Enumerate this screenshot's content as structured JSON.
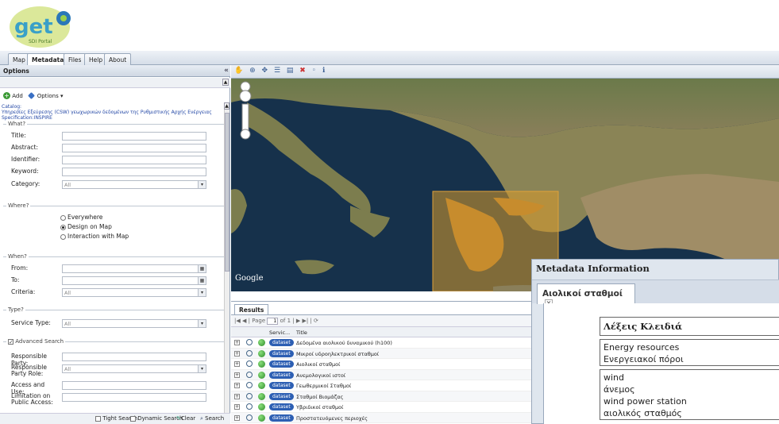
{
  "header": {
    "logo_text": "get",
    "logo_sub": "SDI Portal"
  },
  "tabs": [
    "Map",
    "Metadata",
    "Files",
    "Help",
    "About"
  ],
  "left": {
    "title": "Options",
    "toolbar": {
      "add": "Add",
      "options": "Options ▾"
    },
    "catalog": "Catalog:\nΥπηρεσίες Εξεύρεσης (CSW) γεωχωρικών δεδομένων της Ρυθμιστικής Αρχής Ενέργειας\nSpecification:INSPIRE",
    "what": {
      "legend": "What?",
      "title": "Title:",
      "abstract": "Abstract:",
      "identifier": "Identifier:",
      "keyword": "Keyword:",
      "category": "Category:",
      "category_value": "All"
    },
    "where": {
      "legend": "Where?",
      "options": [
        "Everywhere",
        "Design on Map",
        "Interaction with Map"
      ],
      "selected": 1
    },
    "when": {
      "legend": "When?",
      "from": "From:",
      "to": "To:",
      "criteria": "Criteria:",
      "criteria_value": "All"
    },
    "type": {
      "legend": "Type?",
      "service_type": "Service Type:",
      "service_value": "All"
    },
    "advanced": {
      "legend": "Advanced Search",
      "responsible_party": "Responsible Party:",
      "responsible_role": "Responsible Party Role:",
      "role_value": "All",
      "access": "Access and Use:",
      "limitation": "Limitation on Public Access:"
    },
    "bottom": {
      "tight": "Tight Search",
      "dynamic": "Dynamic Search",
      "clear": "Clear",
      "search": "Search"
    }
  },
  "map": {
    "attribution": "Google"
  },
  "results": {
    "tab": "Results",
    "pager": {
      "page_label": "Page",
      "page": "1",
      "of": "of 1"
    },
    "columns": [
      "Servic...",
      "Title"
    ],
    "rows": [
      {
        "type": "dataset",
        "title": "Δεδομένα αιολικού δυναμικού (h100)"
      },
      {
        "type": "dataset",
        "title": "Μικροί υδροηλεκτρικοί σταθμοί"
      },
      {
        "type": "dataset",
        "title": "Αιολικοί σταθμοί"
      },
      {
        "type": "dataset",
        "title": "Ανεμολογικοί ιστοί"
      },
      {
        "type": "dataset",
        "title": "Γεωθερμικοί Σταθμοί"
      },
      {
        "type": "dataset",
        "title": "Σταθμοί Βιομάζας"
      },
      {
        "type": "dataset",
        "title": "Υβριδικοί σταθμοί"
      },
      {
        "type": "dataset",
        "title": "Προστατευόμενες περιοχές"
      }
    ]
  },
  "metadata_window": {
    "title": "Metadata Information",
    "tab": "Αιολικοί σταθμοί",
    "keywords_header": "Λέξεις Κλειδιά",
    "group1": [
      "Energy resources",
      "Ενεργειακοί πόροι"
    ],
    "group2": [
      "wind",
      "άνεμος",
      "wind power station",
      "αιολικός σταθμός"
    ]
  }
}
